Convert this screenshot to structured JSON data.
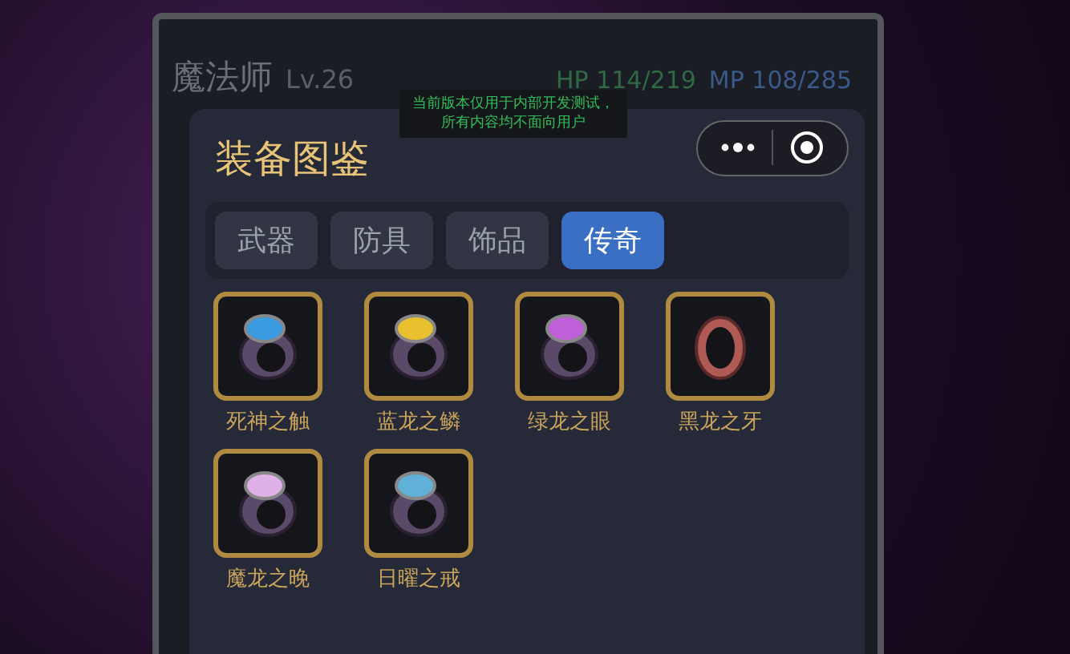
{
  "header": {
    "class_name": "魔法师",
    "level": "Lv.26",
    "hp": "HP 114/219",
    "mp": "MP 108/285"
  },
  "notice": {
    "lines": [
      "当前版本仅用于内部开发测试，",
      "所有内容均不面向用户"
    ]
  },
  "panel": {
    "title": "装备图鉴"
  },
  "tabs": [
    {
      "label": "武器",
      "selected": false
    },
    {
      "label": "防具",
      "selected": false
    },
    {
      "label": "饰品",
      "selected": false
    },
    {
      "label": "传奇",
      "selected": true
    }
  ],
  "items": [
    {
      "name": "死神之触",
      "color": "#3a9be0"
    },
    {
      "name": "蓝龙之鳞",
      "color": "#e8c030"
    },
    {
      "name": "绿龙之眼",
      "color": "#c060d8"
    },
    {
      "name": "黑龙之牙",
      "color": "#b05a55"
    },
    {
      "name": "魔龙之晚",
      "color": "#e0b0e8"
    },
    {
      "name": "日曜之戒",
      "color": "#60b0d8"
    }
  ]
}
